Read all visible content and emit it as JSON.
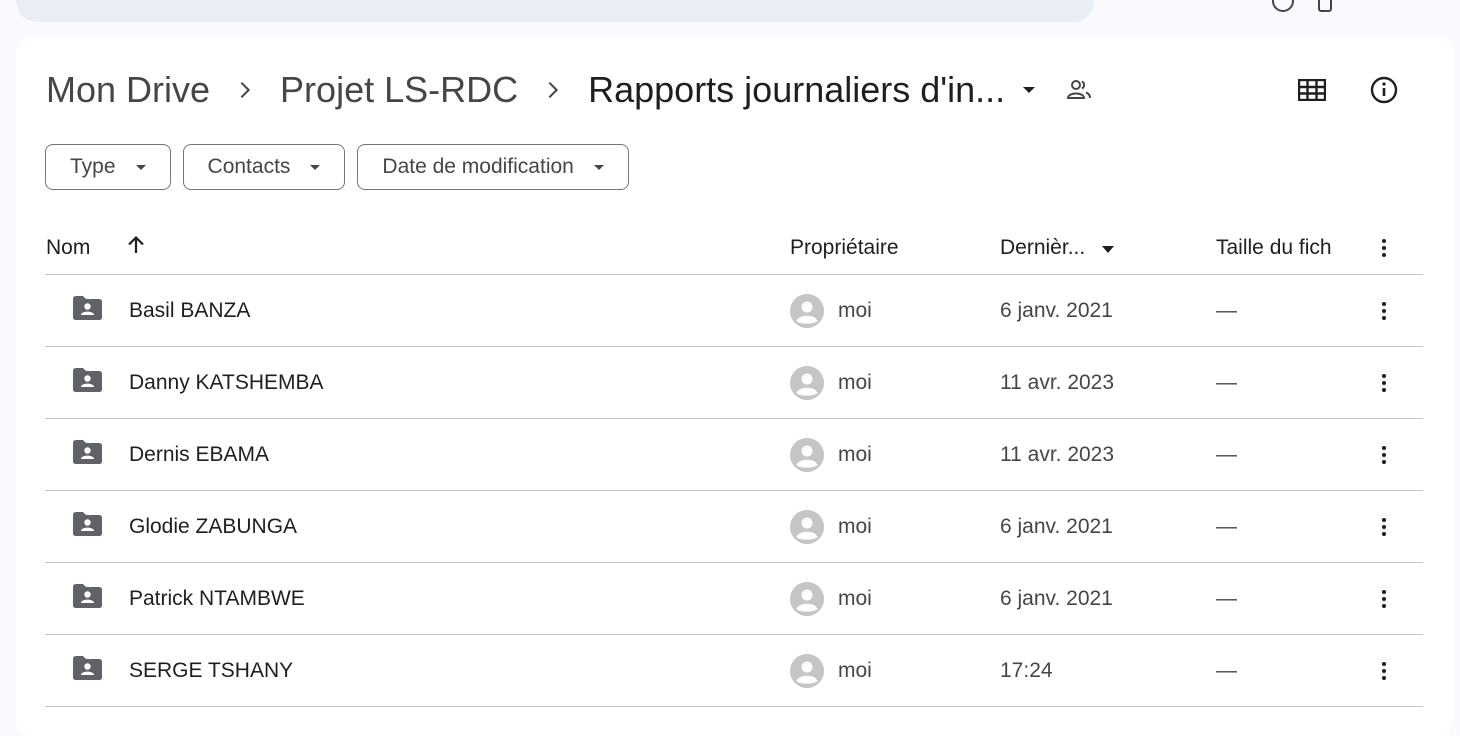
{
  "breadcrumb": {
    "items": [
      "Mon Drive",
      "Projet LS-RDC",
      "Rapports journaliers d'in..."
    ]
  },
  "filters": {
    "type": "Type",
    "contacts": "Contacts",
    "modified": "Date de modification"
  },
  "table": {
    "columns": {
      "name": "Nom",
      "owner": "Propriétaire",
      "modified": "Dernièr...",
      "size": "Taille du fich"
    },
    "rows": [
      {
        "name": "Basil BANZA",
        "owner": "moi",
        "modified": "6 janv. 2021",
        "size": "—"
      },
      {
        "name": "Danny KATSHEMBA",
        "owner": "moi",
        "modified": "11 avr. 2023",
        "size": "—"
      },
      {
        "name": "Dernis EBAMA",
        "owner": "moi",
        "modified": "11 avr. 2023",
        "size": "—"
      },
      {
        "name": "Glodie ZABUNGA",
        "owner": "moi",
        "modified": "6 janv. 2021",
        "size": "—"
      },
      {
        "name": "Patrick NTAMBWE",
        "owner": "moi",
        "modified": "6 janv. 2021",
        "size": "—"
      },
      {
        "name": "SERGE TSHANY",
        "owner": "moi",
        "modified": "17:24",
        "size": "—"
      }
    ]
  },
  "icons": {
    "row_icon": "shared-folder-icon",
    "owner_icon": "account-circle-icon",
    "grid_view": "grid-view-icon",
    "details": "info-icon",
    "shared": "shared-people-icon",
    "sort": "arrow-up-icon",
    "more": "more-vert-icon"
  },
  "colors": {
    "background": "#f8fafd",
    "panel": "#ffffff",
    "search_bar": "#e9eef6",
    "text": "#1f1f1f",
    "muted": "#444746",
    "divider": "#c7c7c7",
    "folder_icon": "#5f6368",
    "avatar": "#c4c7c5"
  }
}
